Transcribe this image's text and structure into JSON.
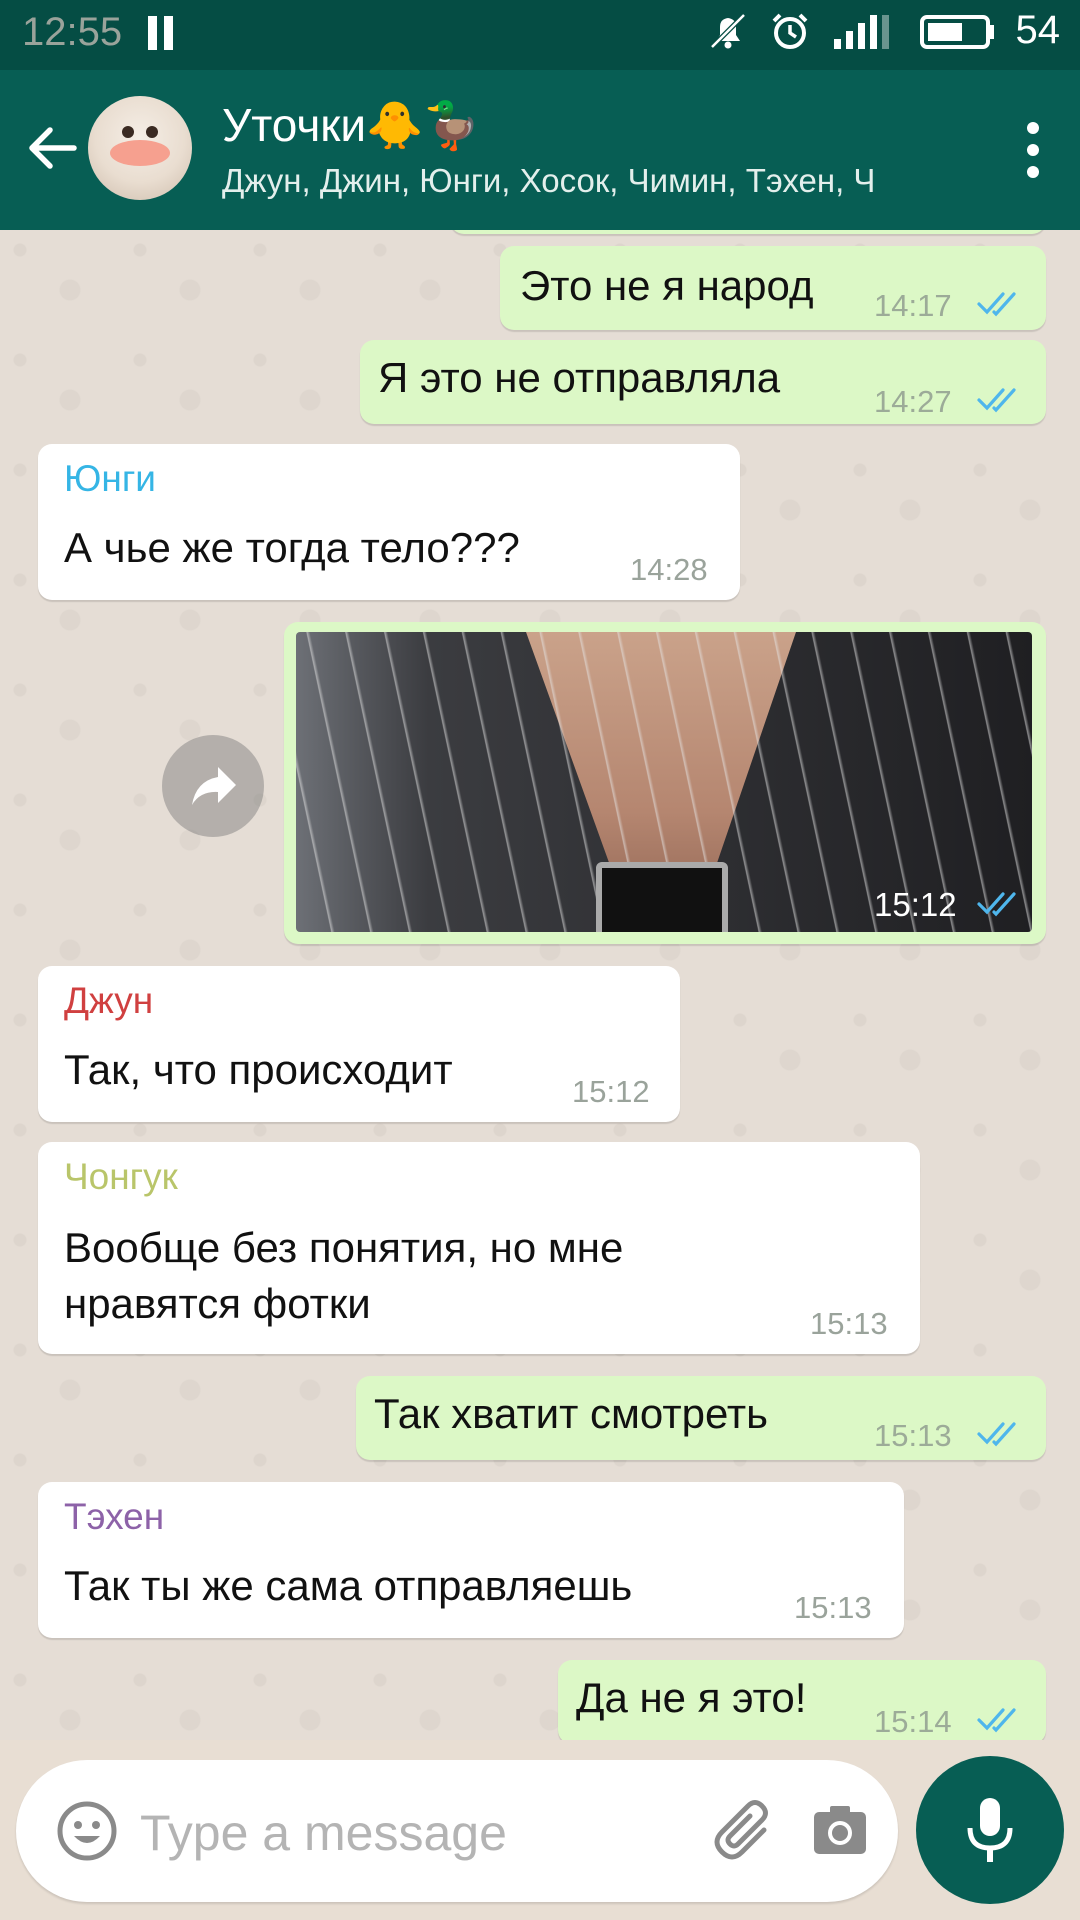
{
  "status_bar": {
    "time": "12:55",
    "battery": "54"
  },
  "header": {
    "title": "Уточки🐥🦆",
    "subtitle": "Джун, Джин, Юнги, Хосок, Чимин, Тэхен, Ч"
  },
  "messages": [
    {
      "dir": "out",
      "text": "Это не я народ",
      "time": "14:17"
    },
    {
      "dir": "out",
      "text": "Я это не отправляла",
      "time": "14:27"
    },
    {
      "dir": "in",
      "sender": "Юнги",
      "text": "А чье же тогда тело???",
      "time": "14:28"
    },
    {
      "dir": "out",
      "type": "image",
      "time": "15:12"
    },
    {
      "dir": "in",
      "sender": "Джун",
      "text": "Так, что происходит",
      "time": "15:12"
    },
    {
      "dir": "in",
      "sender": "Чонгук",
      "text_lines": [
        "Вообще без понятия, но мне",
        "нравятся фотки"
      ],
      "time": "15:13"
    },
    {
      "dir": "out",
      "text": "Так хватит смотреть",
      "time": "15:13"
    },
    {
      "dir": "in",
      "sender": "Тэхен",
      "text": "Так ты же сама отправляешь",
      "time": "15:13"
    },
    {
      "dir": "out",
      "text": "Да не я это!",
      "time": "15:14"
    }
  ],
  "colors": {
    "sender_yungi": "#35b5e5",
    "sender_jun": "#d04040",
    "sender_jongguk": "#b9c56a",
    "sender_tehen": "#8d62a8",
    "ticks_read": "#4fb6ec"
  },
  "input": {
    "placeholder": "Type a message"
  },
  "icons": [
    "back-arrow-icon",
    "more-vert-icon",
    "share-icon",
    "emoji-icon",
    "attach-icon",
    "camera-icon",
    "mic-icon",
    "double-check-icon"
  ]
}
